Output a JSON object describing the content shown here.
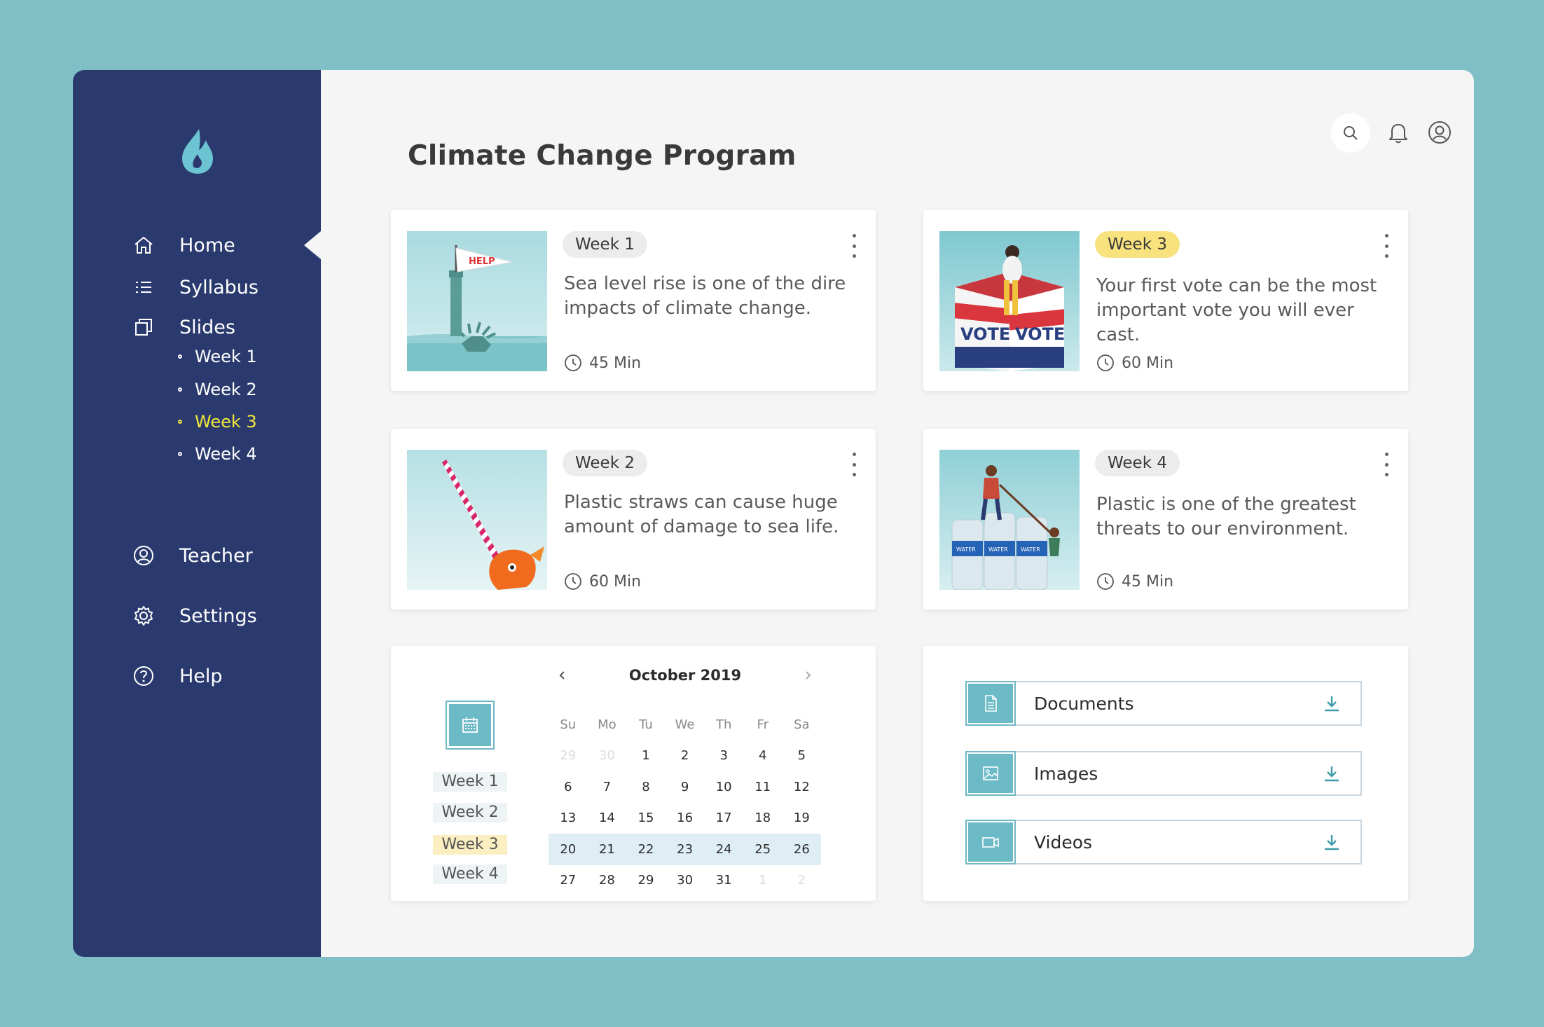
{
  "app": {
    "title": "Climate Change Program",
    "colors": {
      "sidebar": "#2b3a6e",
      "accent": "#6cbac6",
      "highlight": "#f8e27e",
      "active_nav": "#f3e83a",
      "background": "#81bfc7"
    }
  },
  "sidebar": {
    "logo": "droplet-flame-icon",
    "items": [
      {
        "label": "Home",
        "icon": "home-icon",
        "active": true
      },
      {
        "label": "Syllabus",
        "icon": "list-icon"
      },
      {
        "label": "Slides",
        "icon": "slides-icon"
      },
      {
        "label": "Teacher",
        "icon": "user-circle-icon"
      },
      {
        "label": "Settings",
        "icon": "gear-icon"
      },
      {
        "label": "Help",
        "icon": "help-icon"
      }
    ],
    "slides_sub": [
      {
        "label": "Week 1"
      },
      {
        "label": "Week 2"
      },
      {
        "label": "Week 3",
        "active": true
      },
      {
        "label": "Week 4"
      }
    ]
  },
  "header": {
    "icons": [
      "search-icon",
      "bell-icon",
      "account-icon"
    ]
  },
  "lessons": [
    {
      "week": "Week 1",
      "description": "Sea level rise is one of the dire impacts of climate change.",
      "duration": "45 Min",
      "image_text": "HELP"
    },
    {
      "week": "Week 3",
      "description": "Your first vote can be the most important vote you will ever cast.",
      "duration": "60 Min",
      "highlight": true,
      "image_text": "VOTE"
    },
    {
      "week": "Week 2",
      "description": "Plastic straws can cause huge amount of damage to sea life.",
      "duration": "60 Min"
    },
    {
      "week": "Week 4",
      "description": "Plastic is one of the greatest threats to our environment.",
      "duration": "45 Min",
      "image_text": "WATER"
    }
  ],
  "calendar": {
    "month": "October 2019",
    "days_of_week": [
      "Su",
      "Mo",
      "Tu",
      "We",
      "Th",
      "Fr",
      "Sa"
    ],
    "rows": [
      [
        "29",
        "30",
        "1",
        "2",
        "3",
        "4",
        "5"
      ],
      [
        "6",
        "7",
        "8",
        "9",
        "10",
        "11",
        "12"
      ],
      [
        "13",
        "14",
        "15",
        "16",
        "17",
        "18",
        "19"
      ],
      [
        "20",
        "21",
        "22",
        "23",
        "24",
        "25",
        "26"
      ],
      [
        "27",
        "28",
        "29",
        "30",
        "31",
        "1",
        "2"
      ]
    ],
    "selected_row": 3,
    "weeks": [
      "Week 1",
      "Week 2",
      "Week 3",
      "Week 4"
    ],
    "highlight_week": "Week 3"
  },
  "resources": [
    {
      "label": "Documents",
      "icon": "document-icon"
    },
    {
      "label": "Images",
      "icon": "image-icon"
    },
    {
      "label": "Videos",
      "icon": "video-icon"
    }
  ]
}
